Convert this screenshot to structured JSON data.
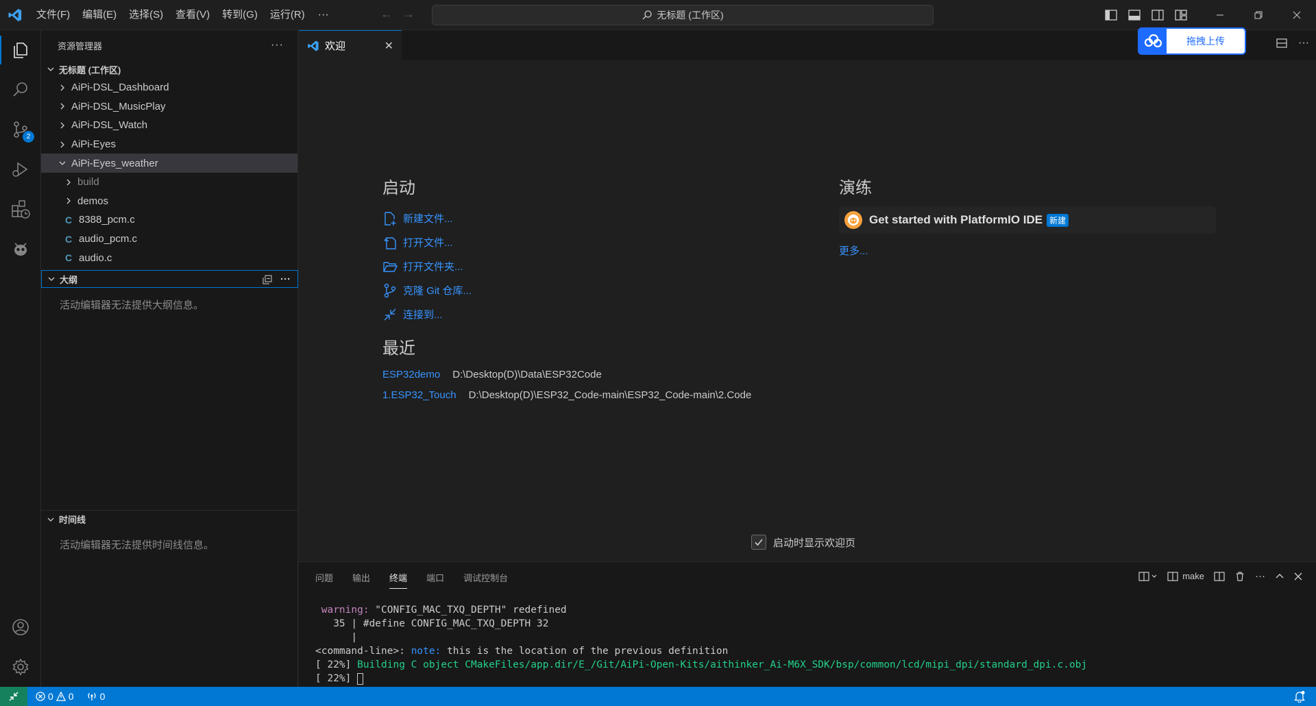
{
  "titlebar": {
    "menus": [
      "文件(F)",
      "编辑(E)",
      "选择(S)",
      "查看(V)",
      "转到(G)",
      "运行(R)"
    ],
    "more": "···",
    "command_center": "无标题 (工作区)"
  },
  "activity": {
    "scm_badge": "2"
  },
  "sidebar": {
    "title": "资源管理器",
    "more": "···",
    "workspace": "无标题 (工作区)",
    "tree": [
      {
        "label": "AiPi-DSL_Dashboard",
        "kind": "folder",
        "level": 1,
        "open": false
      },
      {
        "label": "AiPi-DSL_MusicPlay",
        "kind": "folder",
        "level": 1,
        "open": false
      },
      {
        "label": "AiPi-DSL_Watch",
        "kind": "folder",
        "level": 1,
        "open": false
      },
      {
        "label": "AiPi-Eyes",
        "kind": "folder",
        "level": 1,
        "open": false
      },
      {
        "label": "AiPi-Eyes_weather",
        "kind": "folder",
        "level": 1,
        "open": true,
        "selected": true
      },
      {
        "label": "build",
        "kind": "folder",
        "level": 2,
        "open": false,
        "dim": true
      },
      {
        "label": "demos",
        "kind": "folder",
        "level": 2,
        "open": false
      },
      {
        "label": "8388_pcm.c",
        "kind": "c",
        "level": 2
      },
      {
        "label": "audio_pcm.c",
        "kind": "c",
        "level": 2
      },
      {
        "label": "audio.c",
        "kind": "c",
        "level": 2
      }
    ],
    "c_glyph": "C",
    "outline": {
      "title": "大纲",
      "message": "活动编辑器无法提供大纲信息。",
      "more": "···"
    },
    "timeline": {
      "title": "时间线",
      "message": "活动编辑器无法提供时间线信息。"
    }
  },
  "editor": {
    "tab_label": "欢迎",
    "upload_label": "拖拽上传",
    "start": {
      "title": "启动",
      "links": [
        "新建文件...",
        "打开文件...",
        "打开文件夹...",
        "克隆 Git 仓库...",
        "连接到..."
      ]
    },
    "recent": {
      "title": "最近",
      "items": [
        {
          "name": "ESP32demo",
          "path": "D:\\Desktop(D)\\Data\\ESP32Code"
        },
        {
          "name": "1.ESP32_Touch",
          "path": "D:\\Desktop(D)\\ESP32_Code-main\\ESP32_Code-main\\2.Code"
        }
      ]
    },
    "walkthrough": {
      "title": "演练",
      "card_label": "Get started with PlatformIO IDE",
      "badge": "新建",
      "more": "更多..."
    },
    "startup_checkbox": "启动时显示欢迎页"
  },
  "panel": {
    "tabs": [
      "问题",
      "输出",
      "终端",
      "端口",
      "调试控制台"
    ],
    "active_tab": "终端",
    "terminal_name": "make",
    "more": "···",
    "lines": {
      "l1_warn": "warning:",
      "l1_rest": " \"CONFIG_MAC_TXQ_DEPTH\" redefined",
      "l2": "   35 | #define CONFIG_MAC_TXQ_DEPTH 32",
      "l3": "      |",
      "l4_prefix": "<command-line>: ",
      "l4_note": "note:",
      "l4_rest": " this is the location of the previous definition",
      "l5_prefix": "[ 22%] ",
      "l5_build": "Building C object CMakeFiles/app.dir/E_/Git/AiPi-Open-Kits/aithinker_Ai-M6X_SDK/bsp/common/lcd/mipi_dpi/standard_dpi.c.obj",
      "l6_prefix": "[ 22%] "
    }
  },
  "statusbar": {
    "errors": "0",
    "warnings": "0",
    "ports": "0"
  },
  "colors": {
    "accent": "#0078d4",
    "link": "#3794ff",
    "remote": "#16825d"
  }
}
